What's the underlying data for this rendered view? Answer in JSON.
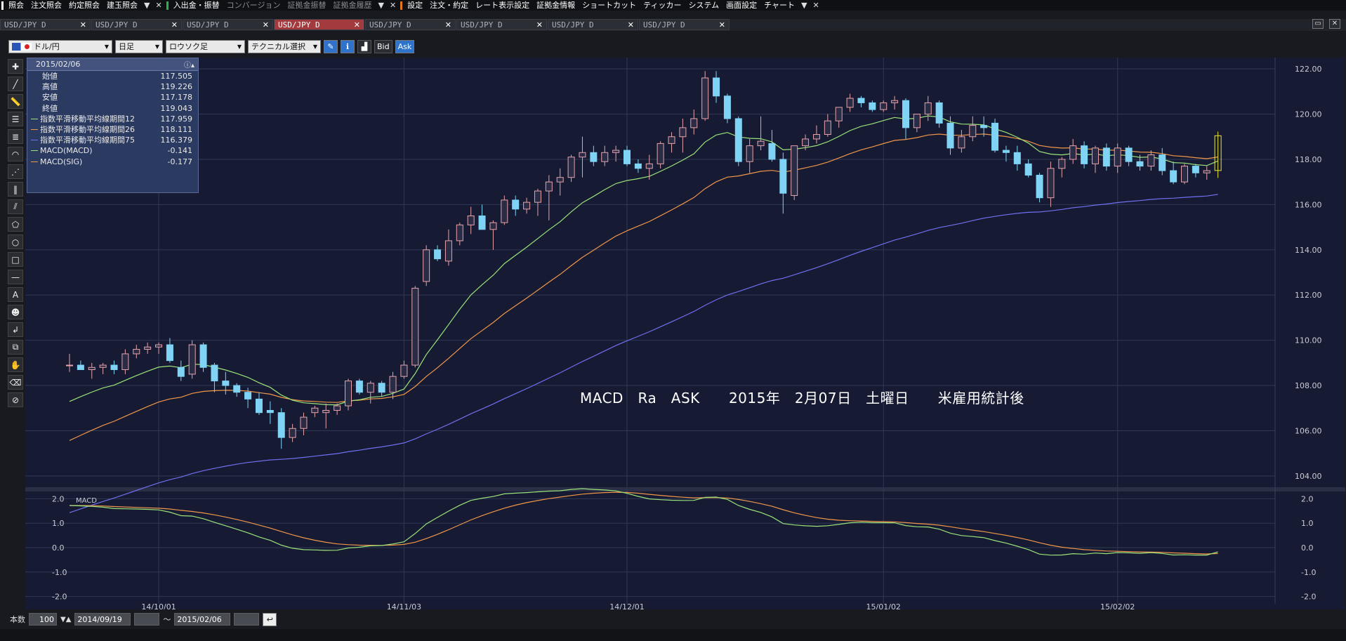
{
  "menubar": {
    "items": [
      {
        "label": "照会",
        "dim": false,
        "sepBefore": "#fff"
      },
      {
        "label": "注文照会",
        "dim": false
      },
      {
        "label": "約定照会",
        "dim": false
      },
      {
        "label": "建玉照会",
        "dim": false
      },
      {
        "label": "入出金・振替",
        "dim": false,
        "sepBefore": "#29b34a"
      },
      {
        "label": "コンバージョン",
        "dim": true
      },
      {
        "label": "証拠金振替",
        "dim": true
      },
      {
        "label": "証拠金履歴",
        "dim": true
      },
      {
        "label": "設定",
        "dim": false,
        "sepBefore": "#e0781c"
      },
      {
        "label": "注文・約定",
        "dim": false
      },
      {
        "label": "レート表示設定",
        "dim": false
      },
      {
        "label": "証拠金情報",
        "dim": false
      },
      {
        "label": "ショートカット",
        "dim": false
      },
      {
        "label": "ティッカー",
        "dim": false
      },
      {
        "label": "システム",
        "dim": false
      },
      {
        "label": "画面設定",
        "dim": false
      },
      {
        "label": "チャート",
        "dim": false
      }
    ]
  },
  "tabs": [
    {
      "label": "USD/JPY D",
      "active": false
    },
    {
      "label": "USD/JPY D",
      "active": false
    },
    {
      "label": "USD/JPY D",
      "active": false
    },
    {
      "label": "USD/JPY D",
      "active": true
    },
    {
      "label": "USD/JPY D",
      "active": false
    },
    {
      "label": "USD/JPY D",
      "active": false
    },
    {
      "label": "USD/JPY D",
      "active": false
    },
    {
      "label": "USD/JPY D",
      "active": false
    }
  ],
  "toolbar": {
    "pair": "ドル/円",
    "period": "日足",
    "chart_type": "ロウソク足",
    "technical": "テクニカル選択",
    "bid": "Bid",
    "ask": "Ask"
  },
  "info": {
    "date": "2015/02/06",
    "rows": [
      {
        "label": "始値",
        "value": "117.505",
        "color": ""
      },
      {
        "label": "高値",
        "value": "119.226",
        "color": ""
      },
      {
        "label": "安値",
        "value": "117.178",
        "color": ""
      },
      {
        "label": "終値",
        "value": "119.043",
        "color": ""
      },
      {
        "label": "指数平滑移動平均線期間12",
        "value": "117.959",
        "color": "#9be37a"
      },
      {
        "label": "指数平滑移動平均線期間26",
        "value": "118.111",
        "color": "#f0964a"
      },
      {
        "label": "指数平滑移動平均線期間75",
        "value": "116.379",
        "color": "#6f6ff0"
      },
      {
        "label": "MACD(MACD)",
        "value": "-0.141",
        "color": "#9be37a"
      },
      {
        "label": "MACD(SIG)",
        "value": "-0.177",
        "color": "#f0964a"
      }
    ]
  },
  "annotation": "MACD   Ra   ASK      2015年   2月07日   土曜日      米雇用統計後",
  "bottom": {
    "count_label": "本数",
    "count": "100",
    "date_from": "2014/09/19",
    "tilde": "～",
    "date_to": "2015/02/06"
  },
  "colors": {
    "bull": "#e7a3ab",
    "bear": "#7fd3f5",
    "ema12": "#9be37a",
    "ema26": "#f0964a",
    "ema75": "#6f6ff0",
    "grid": "#2f3856",
    "last_bar": "#e9e53c"
  },
  "chart_data": {
    "type": "candlestick",
    "price_axis": {
      "ylim": [
        103.5,
        122.5
      ],
      "ticks": [
        "122.00",
        "120.00",
        "118.00",
        "116.00",
        "114.00",
        "112.00",
        "110.00",
        "108.00",
        "106.00",
        "104.00"
      ]
    },
    "macd_axis": {
      "label": "MACD",
      "ylim": [
        -2.3,
        2.3
      ],
      "ticks": [
        "2.0",
        "1.0",
        "0.0",
        "-1.0",
        "-2.0"
      ]
    },
    "x_labels": [
      {
        "label": "14/10/01",
        "index": 8
      },
      {
        "label": "14/11/03",
        "index": 30
      },
      {
        "label": "14/12/01",
        "index": 50
      },
      {
        "label": "15/01/02",
        "index": 73
      },
      {
        "label": "15/02/02",
        "index": 94
      }
    ],
    "candles": [
      {
        "o": 108.9,
        "h": 109.4,
        "l": 108.6,
        "c": 108.9
      },
      {
        "o": 108.9,
        "h": 109.1,
        "l": 108.7,
        "c": 108.7
      },
      {
        "o": 108.7,
        "h": 109.0,
        "l": 108.3,
        "c": 108.8
      },
      {
        "o": 108.8,
        "h": 109.0,
        "l": 108.5,
        "c": 108.9
      },
      {
        "o": 108.9,
        "h": 109.1,
        "l": 108.5,
        "c": 108.7
      },
      {
        "o": 108.7,
        "h": 109.6,
        "l": 108.5,
        "c": 109.4
      },
      {
        "o": 109.4,
        "h": 109.8,
        "l": 109.2,
        "c": 109.6
      },
      {
        "o": 109.6,
        "h": 109.9,
        "l": 109.4,
        "c": 109.7
      },
      {
        "o": 109.7,
        "h": 109.9,
        "l": 109.4,
        "c": 109.8
      },
      {
        "o": 109.8,
        "h": 110.1,
        "l": 109.0,
        "c": 109.1
      },
      {
        "o": 108.8,
        "h": 109.1,
        "l": 108.2,
        "c": 108.4
      },
      {
        "o": 108.5,
        "h": 110.0,
        "l": 108.3,
        "c": 109.8
      },
      {
        "o": 109.8,
        "h": 109.9,
        "l": 108.6,
        "c": 108.8
      },
      {
        "o": 108.9,
        "h": 109.0,
        "l": 107.7,
        "c": 108.2
      },
      {
        "o": 108.2,
        "h": 108.6,
        "l": 107.6,
        "c": 108.0
      },
      {
        "o": 108.0,
        "h": 108.1,
        "l": 107.5,
        "c": 107.7
      },
      {
        "o": 107.7,
        "h": 107.9,
        "l": 107.0,
        "c": 107.4
      },
      {
        "o": 107.4,
        "h": 107.7,
        "l": 106.7,
        "c": 106.8
      },
      {
        "o": 106.9,
        "h": 107.3,
        "l": 106.3,
        "c": 106.8
      },
      {
        "o": 106.8,
        "h": 107.0,
        "l": 105.2,
        "c": 105.7
      },
      {
        "o": 105.7,
        "h": 106.3,
        "l": 105.5,
        "c": 106.1
      },
      {
        "o": 106.1,
        "h": 106.8,
        "l": 105.8,
        "c": 106.6
      },
      {
        "o": 106.8,
        "h": 107.1,
        "l": 106.6,
        "c": 107.0
      },
      {
        "o": 106.8,
        "h": 107.2,
        "l": 106.1,
        "c": 106.9
      },
      {
        "o": 106.9,
        "h": 107.2,
        "l": 106.7,
        "c": 107.1
      },
      {
        "o": 107.1,
        "h": 108.3,
        "l": 106.9,
        "c": 108.2
      },
      {
        "o": 108.2,
        "h": 108.3,
        "l": 107.6,
        "c": 107.7
      },
      {
        "o": 107.7,
        "h": 108.2,
        "l": 107.2,
        "c": 108.1
      },
      {
        "o": 108.1,
        "h": 108.2,
        "l": 107.5,
        "c": 107.7
      },
      {
        "o": 107.7,
        "h": 108.6,
        "l": 107.4,
        "c": 108.4
      },
      {
        "o": 108.4,
        "h": 109.1,
        "l": 108.3,
        "c": 108.9
      },
      {
        "o": 108.9,
        "h": 112.4,
        "l": 108.8,
        "c": 112.3
      },
      {
        "o": 112.6,
        "h": 114.2,
        "l": 112.4,
        "c": 114.0
      },
      {
        "o": 114.0,
        "h": 114.2,
        "l": 113.5,
        "c": 113.6
      },
      {
        "o": 113.5,
        "h": 114.9,
        "l": 113.3,
        "c": 114.4
      },
      {
        "o": 114.4,
        "h": 115.2,
        "l": 114.2,
        "c": 115.1
      },
      {
        "o": 115.1,
        "h": 115.9,
        "l": 114.7,
        "c": 115.5
      },
      {
        "o": 115.5,
        "h": 116.0,
        "l": 114.9,
        "c": 114.9
      },
      {
        "o": 114.9,
        "h": 115.3,
        "l": 114.0,
        "c": 115.2
      },
      {
        "o": 115.2,
        "h": 116.4,
        "l": 115.1,
        "c": 116.2
      },
      {
        "o": 116.2,
        "h": 116.4,
        "l": 115.5,
        "c": 115.8
      },
      {
        "o": 115.8,
        "h": 116.3,
        "l": 115.6,
        "c": 116.1
      },
      {
        "o": 116.1,
        "h": 116.7,
        "l": 115.5,
        "c": 116.6
      },
      {
        "o": 116.6,
        "h": 117.3,
        "l": 115.3,
        "c": 117.0
      },
      {
        "o": 117.0,
        "h": 117.6,
        "l": 116.4,
        "c": 117.2
      },
      {
        "o": 117.2,
        "h": 118.2,
        "l": 117.0,
        "c": 118.1
      },
      {
        "o": 118.1,
        "h": 119.0,
        "l": 117.2,
        "c": 118.3
      },
      {
        "o": 118.3,
        "h": 118.6,
        "l": 117.7,
        "c": 117.9
      },
      {
        "o": 117.9,
        "h": 118.6,
        "l": 117.7,
        "c": 118.3
      },
      {
        "o": 118.3,
        "h": 118.6,
        "l": 117.9,
        "c": 118.4
      },
      {
        "o": 118.4,
        "h": 118.6,
        "l": 117.7,
        "c": 117.8
      },
      {
        "o": 117.8,
        "h": 118.0,
        "l": 117.4,
        "c": 117.6
      },
      {
        "o": 117.6,
        "h": 118.2,
        "l": 117.1,
        "c": 117.8
      },
      {
        "o": 117.8,
        "h": 118.8,
        "l": 117.6,
        "c": 118.7
      },
      {
        "o": 118.7,
        "h": 119.2,
        "l": 118.3,
        "c": 119.0
      },
      {
        "o": 119.0,
        "h": 119.8,
        "l": 118.3,
        "c": 119.4
      },
      {
        "o": 119.4,
        "h": 120.2,
        "l": 119.1,
        "c": 119.8
      },
      {
        "o": 119.8,
        "h": 121.9,
        "l": 119.7,
        "c": 121.6
      },
      {
        "o": 121.6,
        "h": 121.9,
        "l": 120.5,
        "c": 120.8
      },
      {
        "o": 120.8,
        "h": 120.9,
        "l": 119.6,
        "c": 119.8
      },
      {
        "o": 119.8,
        "h": 119.9,
        "l": 117.7,
        "c": 117.9
      },
      {
        "o": 117.9,
        "h": 118.9,
        "l": 117.4,
        "c": 118.6
      },
      {
        "o": 118.6,
        "h": 119.9,
        "l": 118.4,
        "c": 118.8
      },
      {
        "o": 118.7,
        "h": 119.3,
        "l": 117.9,
        "c": 118.0
      },
      {
        "o": 118.0,
        "h": 118.3,
        "l": 115.6,
        "c": 116.5
      },
      {
        "o": 116.4,
        "h": 118.6,
        "l": 116.2,
        "c": 118.6
      },
      {
        "o": 118.6,
        "h": 119.1,
        "l": 118.4,
        "c": 118.9
      },
      {
        "o": 118.9,
        "h": 119.5,
        "l": 118.7,
        "c": 119.1
      },
      {
        "o": 119.1,
        "h": 120.0,
        "l": 119.0,
        "c": 119.7
      },
      {
        "o": 119.7,
        "h": 120.3,
        "l": 119.4,
        "c": 120.3
      },
      {
        "o": 120.3,
        "h": 120.9,
        "l": 120.1,
        "c": 120.7
      },
      {
        "o": 120.7,
        "h": 120.8,
        "l": 120.3,
        "c": 120.5
      },
      {
        "o": 120.5,
        "h": 120.6,
        "l": 120.1,
        "c": 120.2
      },
      {
        "o": 120.2,
        "h": 120.6,
        "l": 120.1,
        "c": 120.5
      },
      {
        "o": 120.5,
        "h": 120.8,
        "l": 120.2,
        "c": 120.6
      },
      {
        "o": 120.6,
        "h": 120.7,
        "l": 118.9,
        "c": 119.4
      },
      {
        "o": 119.4,
        "h": 120.0,
        "l": 119.2,
        "c": 120.0
      },
      {
        "o": 120.0,
        "h": 120.8,
        "l": 119.7,
        "c": 120.5
      },
      {
        "o": 120.5,
        "h": 120.6,
        "l": 119.4,
        "c": 119.6
      },
      {
        "o": 119.6,
        "h": 119.9,
        "l": 118.2,
        "c": 118.5
      },
      {
        "o": 118.5,
        "h": 119.3,
        "l": 118.3,
        "c": 119.0
      },
      {
        "o": 119.0,
        "h": 119.9,
        "l": 118.8,
        "c": 119.5
      },
      {
        "o": 119.5,
        "h": 119.9,
        "l": 119.0,
        "c": 119.4
      },
      {
        "o": 119.6,
        "h": 119.8,
        "l": 118.3,
        "c": 118.4
      },
      {
        "o": 118.4,
        "h": 118.6,
        "l": 117.9,
        "c": 118.3
      },
      {
        "o": 118.3,
        "h": 118.6,
        "l": 117.5,
        "c": 117.8
      },
      {
        "o": 117.8,
        "h": 118.0,
        "l": 117.2,
        "c": 117.3
      },
      {
        "o": 117.3,
        "h": 117.4,
        "l": 116.1,
        "c": 116.3
      },
      {
        "o": 116.3,
        "h": 117.9,
        "l": 115.9,
        "c": 117.6
      },
      {
        "o": 117.6,
        "h": 118.1,
        "l": 117.2,
        "c": 118.0
      },
      {
        "o": 118.0,
        "h": 118.9,
        "l": 117.8,
        "c": 118.6
      },
      {
        "o": 118.6,
        "h": 118.8,
        "l": 117.6,
        "c": 117.8
      },
      {
        "o": 117.8,
        "h": 118.6,
        "l": 117.4,
        "c": 118.5
      },
      {
        "o": 118.5,
        "h": 118.7,
        "l": 117.5,
        "c": 117.7
      },
      {
        "o": 117.7,
        "h": 118.7,
        "l": 117.4,
        "c": 118.5
      },
      {
        "o": 118.5,
        "h": 118.6,
        "l": 117.7,
        "c": 117.9
      },
      {
        "o": 117.9,
        "h": 118.2,
        "l": 117.5,
        "c": 117.7
      },
      {
        "o": 117.7,
        "h": 118.4,
        "l": 117.5,
        "c": 118.2
      },
      {
        "o": 118.2,
        "h": 118.5,
        "l": 117.3,
        "c": 117.5
      },
      {
        "o": 117.5,
        "h": 117.9,
        "l": 116.9,
        "c": 117.0
      },
      {
        "o": 117.0,
        "h": 117.8,
        "l": 116.9,
        "c": 117.7
      },
      {
        "o": 117.7,
        "h": 117.8,
        "l": 117.2,
        "c": 117.4
      },
      {
        "o": 117.4,
        "h": 117.7,
        "l": 117.1,
        "c": 117.5
      },
      {
        "o": 117.505,
        "h": 119.226,
        "l": 117.178,
        "c": 119.043
      }
    ]
  }
}
